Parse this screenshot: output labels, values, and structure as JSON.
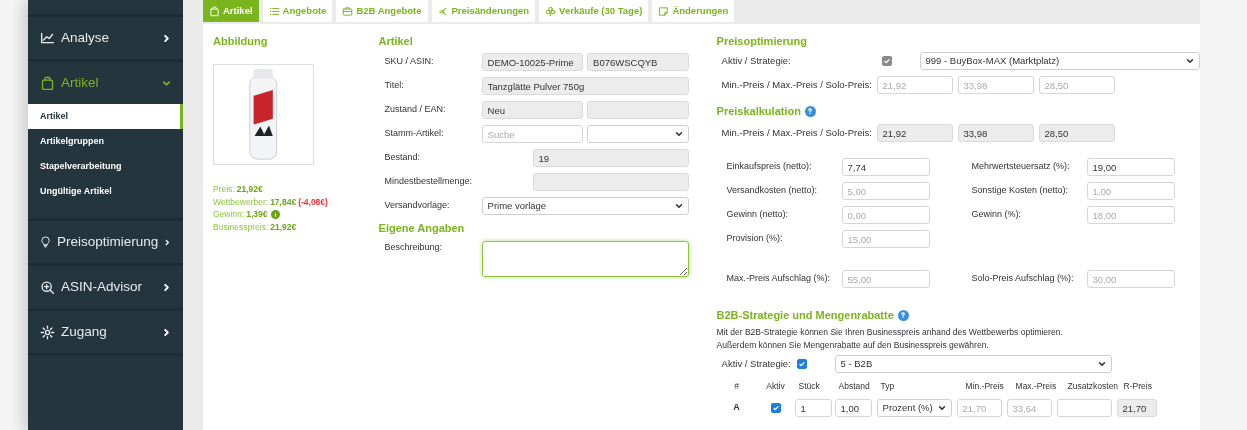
{
  "sidebar": {
    "items": [
      {
        "label": "Analyse",
        "expanded": false,
        "selected": false
      },
      {
        "label": "Artikel",
        "expanded": true,
        "selected": true,
        "children": [
          {
            "label": "Artikel",
            "selected": true
          },
          {
            "label": "Artikelgruppen",
            "selected": false
          },
          {
            "label": "Stapelverarbeitung",
            "selected": false
          },
          {
            "label": "Ungültige Artikel",
            "selected": false
          }
        ]
      },
      {
        "label": "Preisoptimierung",
        "expanded": false,
        "selected": false
      },
      {
        "label": "ASIN-Advisor",
        "expanded": false,
        "selected": false
      },
      {
        "label": "Zugang",
        "expanded": false,
        "selected": false
      }
    ]
  },
  "tabs": [
    {
      "label": "Artikel",
      "selected": true
    },
    {
      "label": "Angebote",
      "selected": false
    },
    {
      "label": "B2B Angebote",
      "selected": false
    },
    {
      "label": "Preisänderungen",
      "selected": false
    },
    {
      "label": "Verkäufe (30 Tage)",
      "selected": false
    },
    {
      "label": "Änderungen",
      "selected": false
    }
  ],
  "image_panel": {
    "heading": "Abbildung",
    "price_info": [
      {
        "label": "Preis:",
        "value": "21,92€"
      },
      {
        "label": "Wettbewerber:",
        "value": "17,84€",
        "delta": "(-4,08€)"
      },
      {
        "label": "Gewinn:",
        "value": "1,39€",
        "info": true
      },
      {
        "label": "Businesspreis:",
        "value": "21,92€"
      }
    ]
  },
  "article": {
    "heading": "Artikel",
    "rows": [
      {
        "label": "SKU / ASIN:",
        "fields": [
          {
            "kind": "readonly",
            "value": "DEMO-10025-Prime"
          },
          {
            "kind": "readonly",
            "value": "B076WSCQYB"
          }
        ]
      },
      {
        "label": "Titel:",
        "fields": [
          {
            "kind": "readonly",
            "value": "Tanzglätte Pulver 750g"
          }
        ]
      },
      {
        "label": "Zustand / EAN:",
        "fields": [
          {
            "kind": "readonly",
            "value": "Neu"
          },
          {
            "kind": "readonly"
          }
        ]
      },
      {
        "label": "Stamm-Artikel:",
        "fields": [
          {
            "kind": "input",
            "placeholder": "Suche"
          },
          {
            "kind": "select"
          }
        ]
      },
      {
        "label": "Bestand:",
        "fields": [
          {
            "kind": "readonly",
            "value": "19"
          }
        ]
      },
      {
        "label": "Mindestbestellmenge:",
        "fields": [
          {
            "kind": "readonly"
          }
        ]
      },
      {
        "label": "Versandvorlage:",
        "fields": [
          {
            "kind": "select",
            "value": "Prime vorlage"
          }
        ]
      }
    ]
  },
  "own": {
    "heading": "Eigene Angaben",
    "label": "Beschreibung:"
  },
  "price_optimization": {
    "heading": "Preisoptimierung",
    "label": "Aktiv / Strategie:",
    "active": true,
    "disabled": true,
    "strategy": "999 - BuyBox-MAX (Marktplatz)",
    "prices_label": "Min.-Preis / Max.-Preis / Solo-Preis:",
    "price_placeholders": [
      "21,92",
      "33,98",
      "28,50"
    ]
  },
  "price_calculation": {
    "heading": "Preiskalkulation",
    "help": true,
    "prices_label": "Min.-Preis / Max.-Preis / Solo-Preis:",
    "prices": [
      "21,92",
      "33,98",
      "28,50"
    ],
    "rows": [
      [
        {
          "label": "Einkaufspreis (netto):",
          "value": "7,74"
        },
        {
          "label": "Mehrwertsteuersatz (%):",
          "value": "19,00"
        }
      ],
      [
        {
          "label": "Versandkosten (netto):",
          "placeholder": "5,00"
        },
        {
          "label": "Sonstige Kosten (netto):",
          "placeholder": "1,00"
        }
      ],
      [
        {
          "label": "Gewinn (netto):",
          "placeholder": "0,00"
        },
        {
          "label": "Gewinn (%):",
          "placeholder": "18,00"
        }
      ],
      [
        {
          "label": "Provision (%):",
          "placeholder": "15,00"
        }
      ],
      [
        {
          "label": "Max.-Preis Aufschlag (%):",
          "placeholder": "55,00"
        },
        {
          "label": "Solo-Preis Aufschlag (%):",
          "placeholder": "30,00"
        }
      ]
    ]
  },
  "b2b": {
    "heading": "B2B-Strategie und Mengenrabatte",
    "help": true,
    "description": [
      "Mit der B2B-Strategie können Sie Ihren Businesspreis anhand des Wettbewerbs optimieren.",
      "Außerdem können Sie Mengenrabatte auf den Businesspreis gewähren."
    ],
    "label": "Aktiv / Strategie:",
    "active": true,
    "strategy": "5 - B2B",
    "columns": [
      "#",
      "Aktiv",
      "Stück",
      "Abstand",
      "Typ",
      "Min.-Preis",
      "Max.-Preis",
      "Zusatzkosten",
      "R-Preis"
    ],
    "rows": [
      {
        "id": "A",
        "active": true,
        "qty": "1",
        "distance": "1,00",
        "type": "Prozent (%)",
        "min_placeholder": "21,70",
        "max_placeholder": "33,64",
        "r_price": "21,70"
      }
    ]
  }
}
